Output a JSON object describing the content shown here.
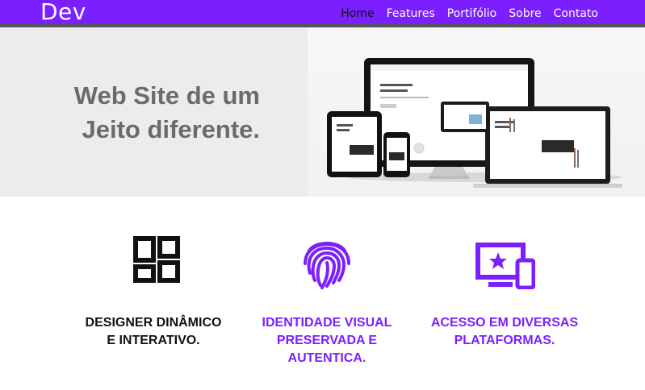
{
  "nav": {
    "brand": "Dev",
    "items": [
      "Home",
      "Features",
      "Portifólio",
      "Sobre",
      "Contato"
    ],
    "active_index": 0
  },
  "hero": {
    "title_line1": "Web Site de um",
    "title_line2": "Jeito diferente.",
    "image_alt": "responsive-devices-mockup"
  },
  "features": [
    {
      "icon": "qr-grid-icon",
      "line1": "DESIGNER DINÂMICO",
      "line2": "E INTERATIVO.",
      "line3": "",
      "color": "#111111"
    },
    {
      "icon": "fingerprint-icon",
      "line1": "IDENTIDADE VISUAL",
      "line2": "PRESERVADA E",
      "line3": "AUTENTICA.",
      "color": "#7b1fff"
    },
    {
      "icon": "devices-star-icon",
      "line1": "ACESSO EM DIVERSAS",
      "line2": "PLATAFORMAS.",
      "line3": "",
      "color": "#7b1fff"
    }
  ],
  "colors": {
    "accent": "#7b1fff",
    "nav_border": "#555555",
    "hero_bg": "#ececec",
    "hero_text": "#6b6b6b"
  }
}
